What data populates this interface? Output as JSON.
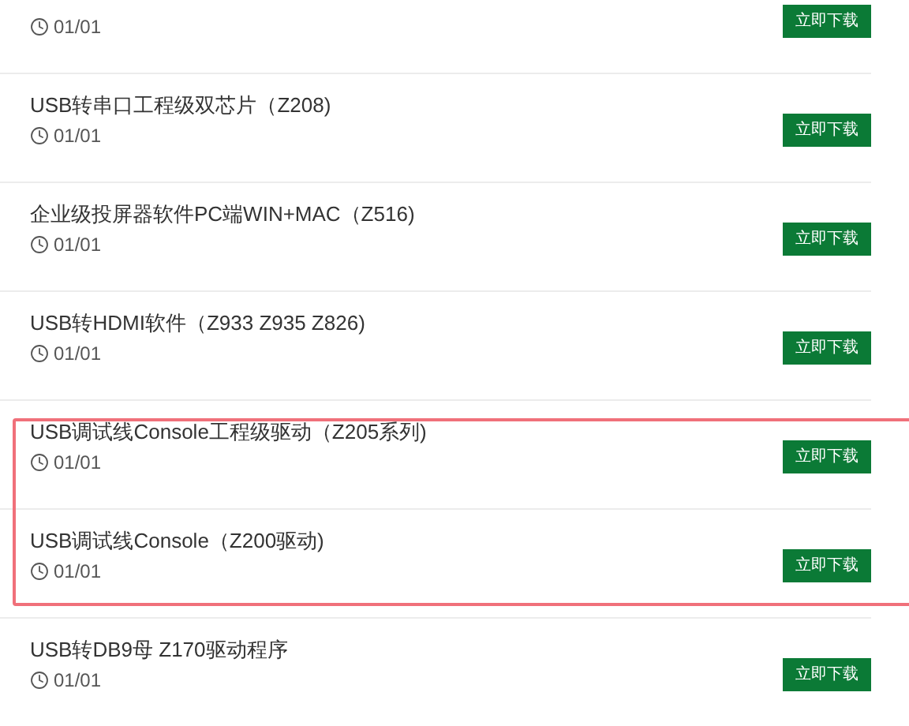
{
  "items": [
    {
      "date": "01/01",
      "button": "立即下载",
      "highlighted": false
    },
    {
      "title": "USB转串口工程级双芯片（Z208)",
      "date": "01/01",
      "button": "立即下载",
      "highlighted": false
    },
    {
      "title": "企业级投屏器软件PC端WIN+MAC（Z516)",
      "date": "01/01",
      "button": "立即下载",
      "highlighted": false
    },
    {
      "title": "USB转HDMI软件（Z933 Z935 Z826)",
      "date": "01/01",
      "button": "立即下载",
      "highlighted": false
    },
    {
      "title": "USB调试线Console工程级驱动（Z205系列)",
      "date": "01/01",
      "button": "立即下载",
      "highlighted": true
    },
    {
      "title": "USB调试线Console（Z200驱动)",
      "date": "01/01",
      "button": "立即下载",
      "highlighted": true
    },
    {
      "title": "USB转DB9母 Z170驱动程序",
      "date": "01/01",
      "button": "立即下载",
      "highlighted": false
    }
  ]
}
